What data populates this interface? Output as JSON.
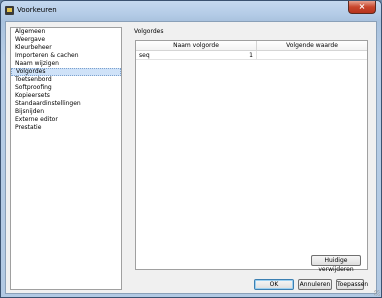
{
  "window": {
    "title": "Voorkeuren",
    "close_glyph": "×",
    "icon": "app-icon"
  },
  "sidebar": {
    "items": [
      {
        "label": "Algemeen"
      },
      {
        "label": "Weergave"
      },
      {
        "label": "Kleurbeheer"
      },
      {
        "label": "Importeren & cachen"
      },
      {
        "label": "Naam wijzigen"
      },
      {
        "label": "Volgordes",
        "selected": true
      },
      {
        "label": "Toetsenbord"
      },
      {
        "label": "Softproofing"
      },
      {
        "label": "Kopieersets"
      },
      {
        "label": "Standaardinstellingen"
      },
      {
        "label": "Bijsnijden"
      },
      {
        "label": "Externe editor"
      },
      {
        "label": "Prestatie"
      }
    ]
  },
  "panel": {
    "title": "Volgordes",
    "columns": [
      "Naam volgorde",
      "Volgende waarde"
    ],
    "rows": [
      {
        "name": "seq",
        "value": "1",
        "next": ""
      }
    ]
  },
  "buttons": {
    "clear": "Huidige verwijderen",
    "ok": "OK",
    "cancel": "Annuleren",
    "apply": "Toepassen"
  }
}
